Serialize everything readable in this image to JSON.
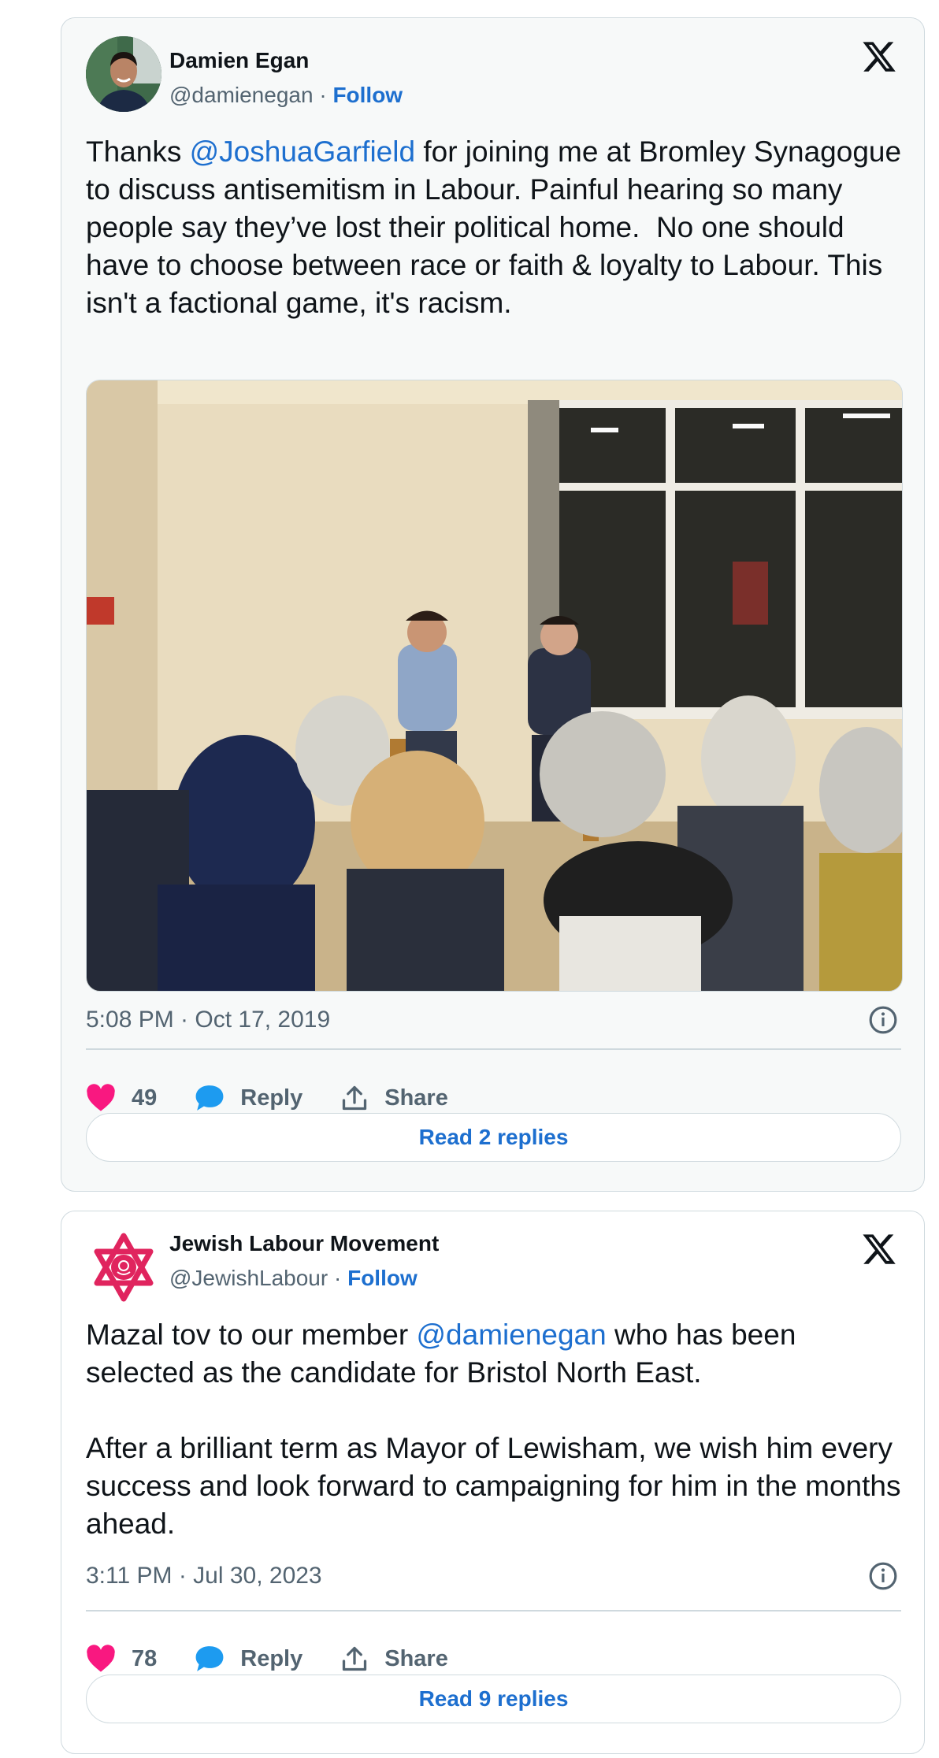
{
  "tweets": [
    {
      "author_name": "Damien Egan",
      "handle": "@damienegan",
      "separator": " · ",
      "follow_label": "Follow",
      "text_before": "Thanks ",
      "mention": "@JoshuaGarfield",
      "text_after": " for joining me at Bromley Synagogue to discuss antisemitism in Labour. Painful hearing so many people say they’ve lost their political home.  No one should have to choose between race or faith & loyalty to Labour. This isn't a factional game, it's racism.",
      "timestamp": "5:08 PM · Oct 17, 2019",
      "likes": "49",
      "reply_label": "Reply",
      "share_label": "Share",
      "read_replies_label": "Read 2 replies"
    },
    {
      "author_name": "Jewish Labour Movement",
      "handle": "@JewishLabour",
      "separator": " · ",
      "follow_label": "Follow",
      "text_before": "Mazal tov to our member ",
      "mention": "@damienegan",
      "text_after": " who has been selected as the candidate for Bristol North East.\n\nAfter a brilliant term as Mayor of Lewisham, we wish him every success and look forward to campaigning for him in the months ahead.",
      "timestamp": "3:11 PM · Jul 30, 2023",
      "likes": "78",
      "reply_label": "Reply",
      "share_label": "Share",
      "read_replies_label": "Read 9 replies"
    }
  ],
  "icons": {
    "platform_logo": "x-logo-icon",
    "info": "info-icon",
    "like": "heart-icon",
    "reply": "speech-bubble-icon",
    "share": "share-upload-icon"
  },
  "colors": {
    "like": "#f91880",
    "reply": "#1d9bf0",
    "link": "#1d6fcf",
    "jlm_logo": "#e0245e"
  }
}
